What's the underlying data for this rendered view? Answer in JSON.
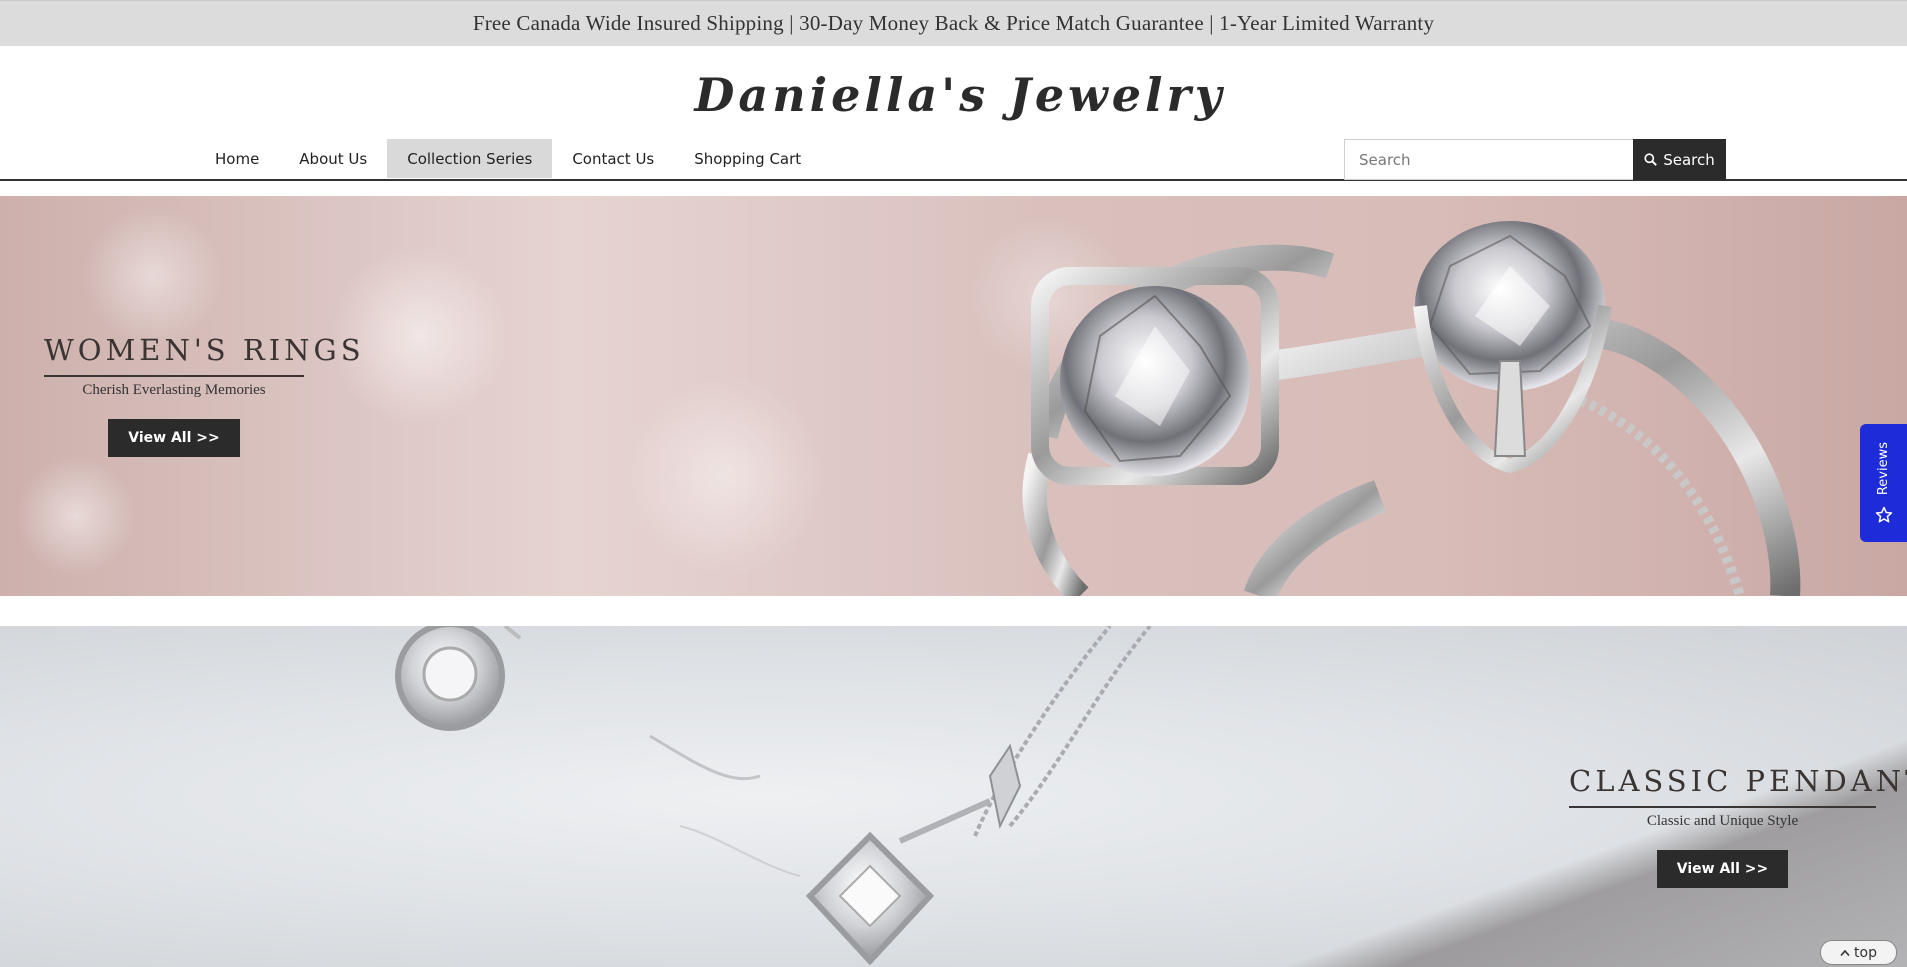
{
  "announcement": "Free Canada Wide Insured Shipping | 30-Day Money Back & Price Match Guarantee | 1-Year Limited Warranty",
  "logo": "Daniella's Jewelry",
  "nav": {
    "items": [
      "Home",
      "About Us",
      "Collection Series",
      "Contact Us",
      "Shopping Cart"
    ],
    "active": "Collection Series"
  },
  "search": {
    "placeholder": "Search",
    "button_label": "Search"
  },
  "banners": [
    {
      "title": "WOMEN'S RINGS",
      "subtitle": "Cherish Everlasting Memories",
      "button": "View All >>"
    },
    {
      "title": "CLASSIC PENDANTS",
      "subtitle": "Classic and Unique Style",
      "button": "View All >>"
    }
  ],
  "reviews_tab": {
    "label": "Reviews",
    "icon": "star-icon",
    "color": "#1e2bd8"
  },
  "back_to_top": {
    "label": "top",
    "icon": "chevron-up-icon"
  }
}
